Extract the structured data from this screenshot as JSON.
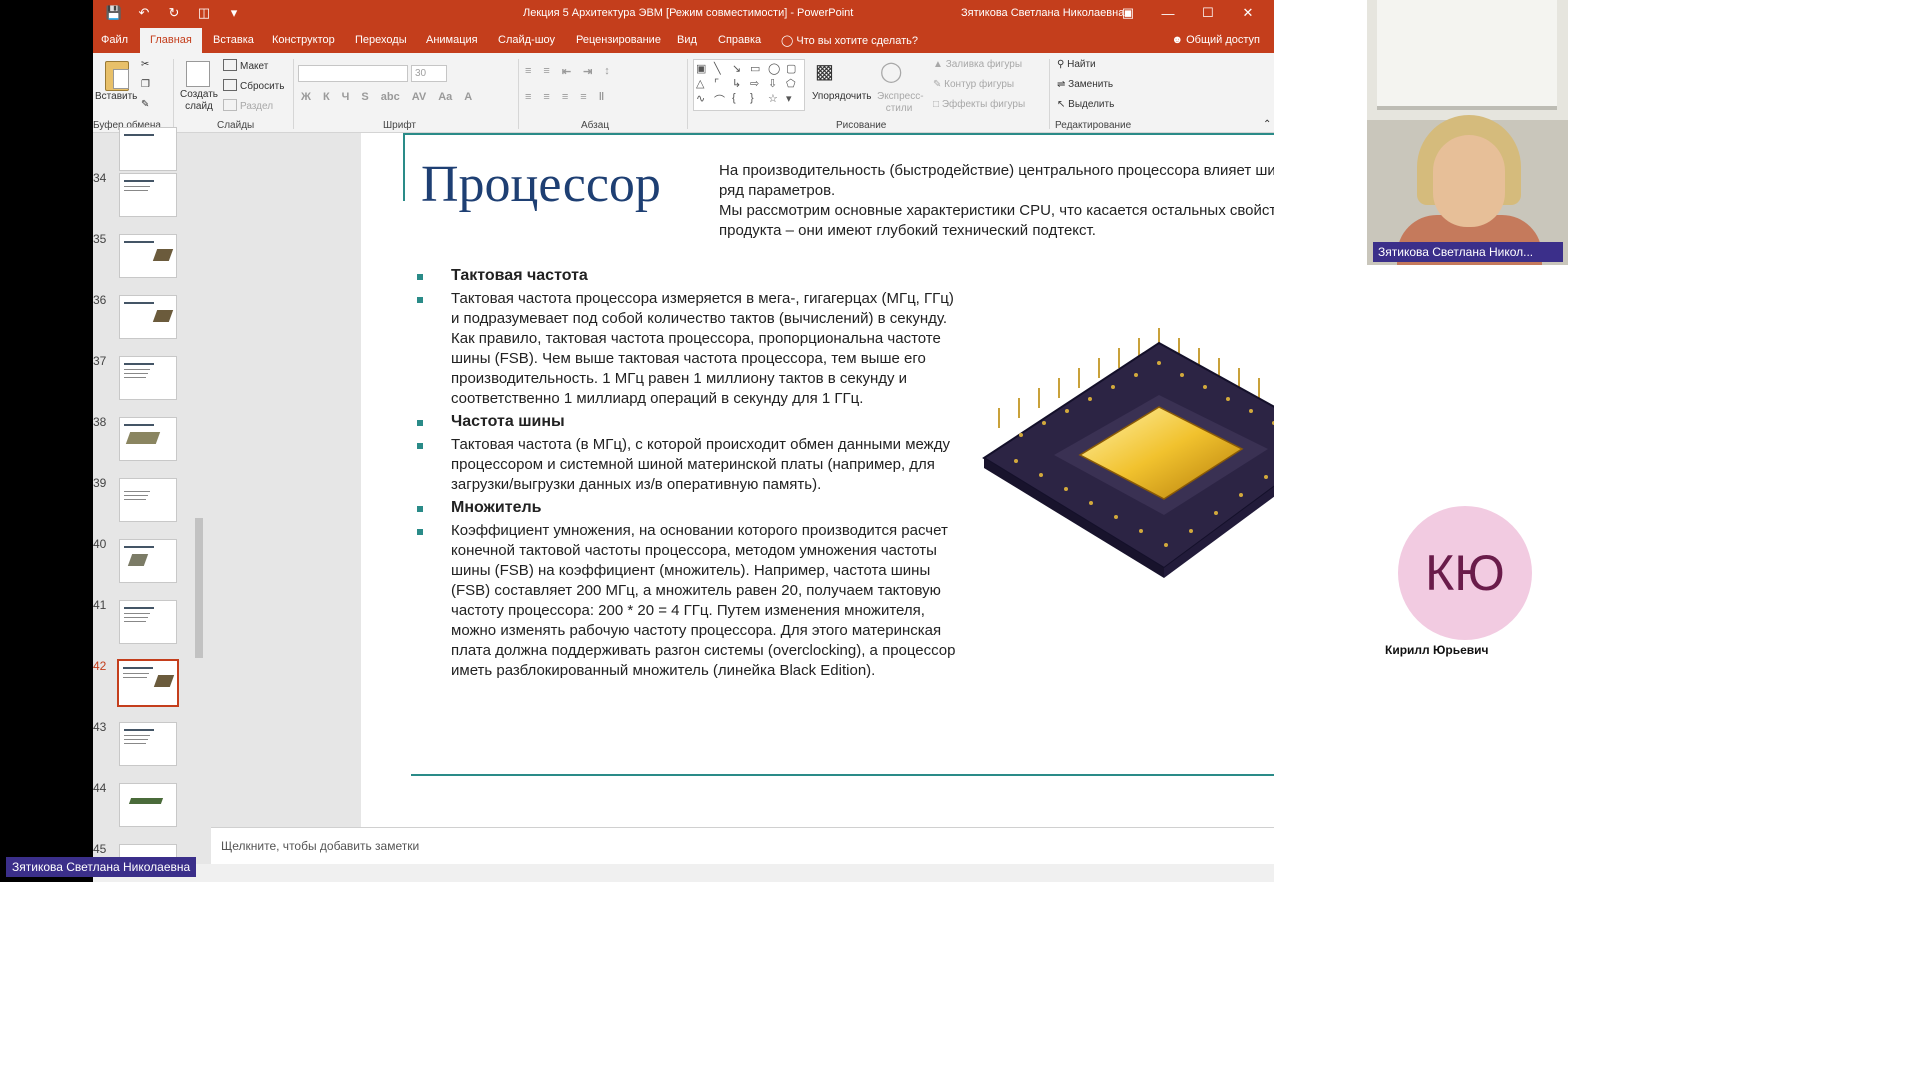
{
  "window": {
    "title": "Лекция 5 Архитектура ЭВМ [Режим совместимости]  -  PowerPoint",
    "user": "Зятикова Светлана Николаевна"
  },
  "tabs": [
    "Файл",
    "Главная",
    "Вставка",
    "Конструктор",
    "Переходы",
    "Анимация",
    "Слайд-шоу",
    "Рецензирование",
    "Вид",
    "Справка"
  ],
  "tell_me": "Что вы хотите сделать?",
  "share": "Общий доступ",
  "ribbon": {
    "paste": "Вставить",
    "clipboard": "Буфер обмена",
    "layout": "Макет",
    "reset": "Сбросить",
    "section": "Раздел",
    "new_slide": "Создать слайд",
    "slides": "Слайды",
    "font_size": "30",
    "font": "Шрифт",
    "paragraph": "Абзац",
    "arrange": "Упорядочить",
    "quick_styles": "Экспресс-стили",
    "shape_fill": "Заливка фигуры",
    "shape_outline": "Контур фигуры",
    "shape_effects": "Эффекты фигуры",
    "drawing": "Рисование",
    "find": "Найти",
    "replace": "Заменить",
    "select": "Выделить",
    "editing": "Редактирование"
  },
  "thumbnails": [
    "34",
    "35",
    "36",
    "37",
    "38",
    "39",
    "40",
    "41",
    "42",
    "43",
    "44",
    "45"
  ],
  "selected_slide": "42",
  "slide": {
    "title": "Процессор",
    "intro": "На производительность (быстродействие) центрального процессора влияет широкий ряд параметров.\nМы рассмотрим основные характеристики CPU, что касается остальных свойств продукта – они имеют глубокий технический подтекст.",
    "bullets": [
      {
        "type": "head",
        "text": "Тактовая частота"
      },
      {
        "type": "body",
        "text": "Тактовая частота процессора измеряется в мега-, гигагерцах (МГц, ГГц) и подразумевает под собой количество тактов (вычислений) в секунду. Как правило, тактовая частота процессора, пропорциональна частоте шины (FSB). Чем выше тактовая частота процессора, тем выше его производительность. 1 МГц равен 1 миллиону тактов в секунду и соответственно 1 миллиард операций в секунду для 1 ГГц."
      },
      {
        "type": "head",
        "text": "Частота шины"
      },
      {
        "type": "body",
        "text": "Тактовая частота (в МГц), с которой происходит обмен данными между процессором и системной шиной материнской платы (например, для загрузки/выгрузки данных из/в оперативную память)."
      },
      {
        "type": "head",
        "text": "Множитель"
      },
      {
        "type": "body",
        "text": "Коэффициент умножения, на основании которого производится расчет конечной тактовой частоты процессора, методом умножения частоты шины (FSB) на коэффициент (множитель). Например, частота шины (FSB) составляет 200 МГц, а множитель равен 20, получаем тактовую частоту процессора: 200 * 20 = 4 ГГц. Путем изменения множителя, можно изменять рабочую частоту процессора. Для этого материнская плата должна поддерживать разгон системы (overclocking), а процессор иметь разблокированный множитель (линейка Black Edition)."
      }
    ],
    "page_number": "42"
  },
  "notes_placeholder": "Щелкните, чтобы добавить заметки",
  "presenter_tag": "Зятикова Светлана Николаевна",
  "camera_label": "Зятикова Светлана Никол...",
  "participant": {
    "initials": "КЮ",
    "name": "Кирилл Юрьевич"
  },
  "colors": {
    "accent": "#c43e1c",
    "slide_line": "#2a8b88",
    "title": "#1e3f73",
    "name_tag": "#3b2f8a",
    "avatar_bg": "#f2cbe1"
  }
}
